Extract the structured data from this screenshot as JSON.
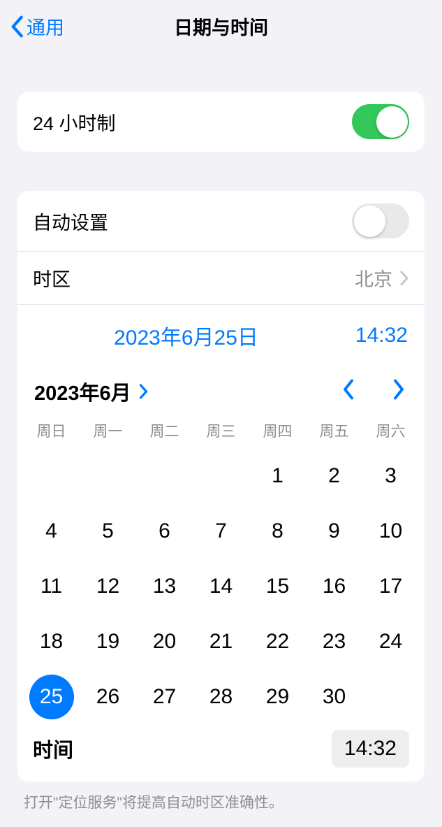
{
  "header": {
    "back_label": "通用",
    "title": "日期与时间"
  },
  "section1": {
    "twenty_four_hour_label": "24 小时制",
    "twenty_four_hour_on": true
  },
  "section2": {
    "auto_set_label": "自动设置",
    "auto_set_on": false,
    "timezone_label": "时区",
    "timezone_value": "北京",
    "selected_date_display": "2023年6月25日",
    "selected_time_display": "14:32"
  },
  "calendar": {
    "month_label": "2023年6月",
    "weekdays": [
      "周日",
      "周一",
      "周二",
      "周三",
      "周四",
      "周五",
      "周六"
    ],
    "leading_blanks": 4,
    "days_in_month": 30,
    "selected_day": 25
  },
  "time_row": {
    "label": "时间",
    "value": "14:32"
  },
  "footer": {
    "note": "打开\"定位服务\"将提高自动时区准确性。"
  },
  "icons": {
    "back": "chevron-left",
    "disclosure": "chevron-right",
    "month_expand": "chevron-right",
    "prev_month": "chevron-left",
    "next_month": "chevron-right"
  }
}
